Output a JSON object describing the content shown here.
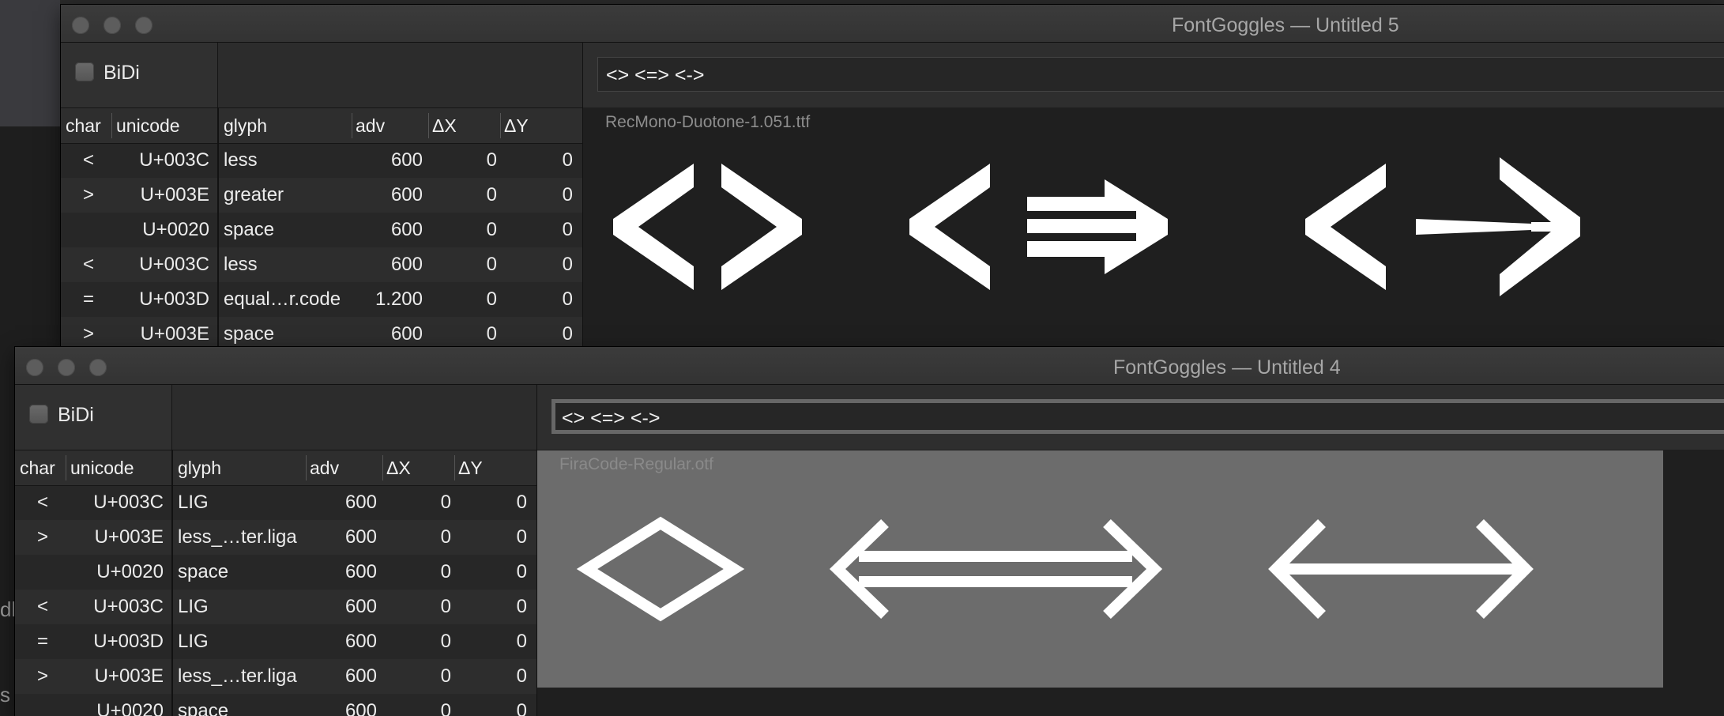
{
  "windows": [
    {
      "title": "FontGoggles — Untitled 5",
      "bidi_label": "BiDi",
      "input_text": "<> <=> <->",
      "font_file": "RecMono-Duotone-1.051.ttf",
      "columns": {
        "char": "char",
        "unicode": "unicode",
        "glyph": "glyph",
        "adv": "adv",
        "dx": "ΔX",
        "dy": "ΔY"
      },
      "rows": [
        {
          "char": "<",
          "unicode": "U+003C",
          "glyph": "less",
          "adv": "600",
          "dx": "0",
          "dy": "0"
        },
        {
          "char": ">",
          "unicode": "U+003E",
          "glyph": "greater",
          "adv": "600",
          "dx": "0",
          "dy": "0"
        },
        {
          "char": "",
          "unicode": "U+0020",
          "glyph": "space",
          "adv": "600",
          "dx": "0",
          "dy": "0"
        },
        {
          "char": "<",
          "unicode": "U+003C",
          "glyph": "less",
          "adv": "600",
          "dx": "0",
          "dy": "0"
        },
        {
          "char": "=",
          "unicode": "U+003D",
          "glyph": "equal…r.code",
          "adv": "1.200",
          "dx": "0",
          "dy": "0"
        },
        {
          "char": ">",
          "unicode": "U+003E",
          "glyph": "space",
          "adv": "600",
          "dx": "0",
          "dy": "0"
        }
      ]
    },
    {
      "title": "FontGoggles — Untitled 4",
      "bidi_label": "BiDi",
      "input_text": "<> <=> <->",
      "font_file": "FiraCode-Regular.otf",
      "columns": {
        "char": "char",
        "unicode": "unicode",
        "glyph": "glyph",
        "adv": "adv",
        "dx": "ΔX",
        "dy": "ΔY"
      },
      "rows": [
        {
          "char": "<",
          "unicode": "U+003C",
          "glyph": "LIG",
          "adv": "600",
          "dx": "0",
          "dy": "0"
        },
        {
          "char": ">",
          "unicode": "U+003E",
          "glyph": "less_…ter.liga",
          "adv": "600",
          "dx": "0",
          "dy": "0"
        },
        {
          "char": "",
          "unicode": "U+0020",
          "glyph": "space",
          "adv": "600",
          "dx": "0",
          "dy": "0"
        },
        {
          "char": "<",
          "unicode": "U+003C",
          "glyph": "LIG",
          "adv": "600",
          "dx": "0",
          "dy": "0"
        },
        {
          "char": "=",
          "unicode": "U+003D",
          "glyph": "LIG",
          "adv": "600",
          "dx": "0",
          "dy": "0"
        },
        {
          "char": ">",
          "unicode": "U+003E",
          "glyph": "less_…ter.liga",
          "adv": "600",
          "dx": "0",
          "dy": "0"
        },
        {
          "char": "",
          "unicode": "U+0020",
          "glyph": "space",
          "adv": "600",
          "dx": "0",
          "dy": "0"
        }
      ]
    }
  ],
  "desktop_fragments": {
    "side_text_1": "dl",
    "side_text_2": "s"
  },
  "icons": {
    "traffic_lights": [
      "close-icon",
      "minimize-icon",
      "zoom-icon"
    ],
    "checkbox": "checkbox-icon"
  },
  "colors": {
    "glyph_fill": "#ffffff",
    "selected_preview_bg": "#6c6c6c",
    "preview_bg": "#1f1f1f"
  }
}
